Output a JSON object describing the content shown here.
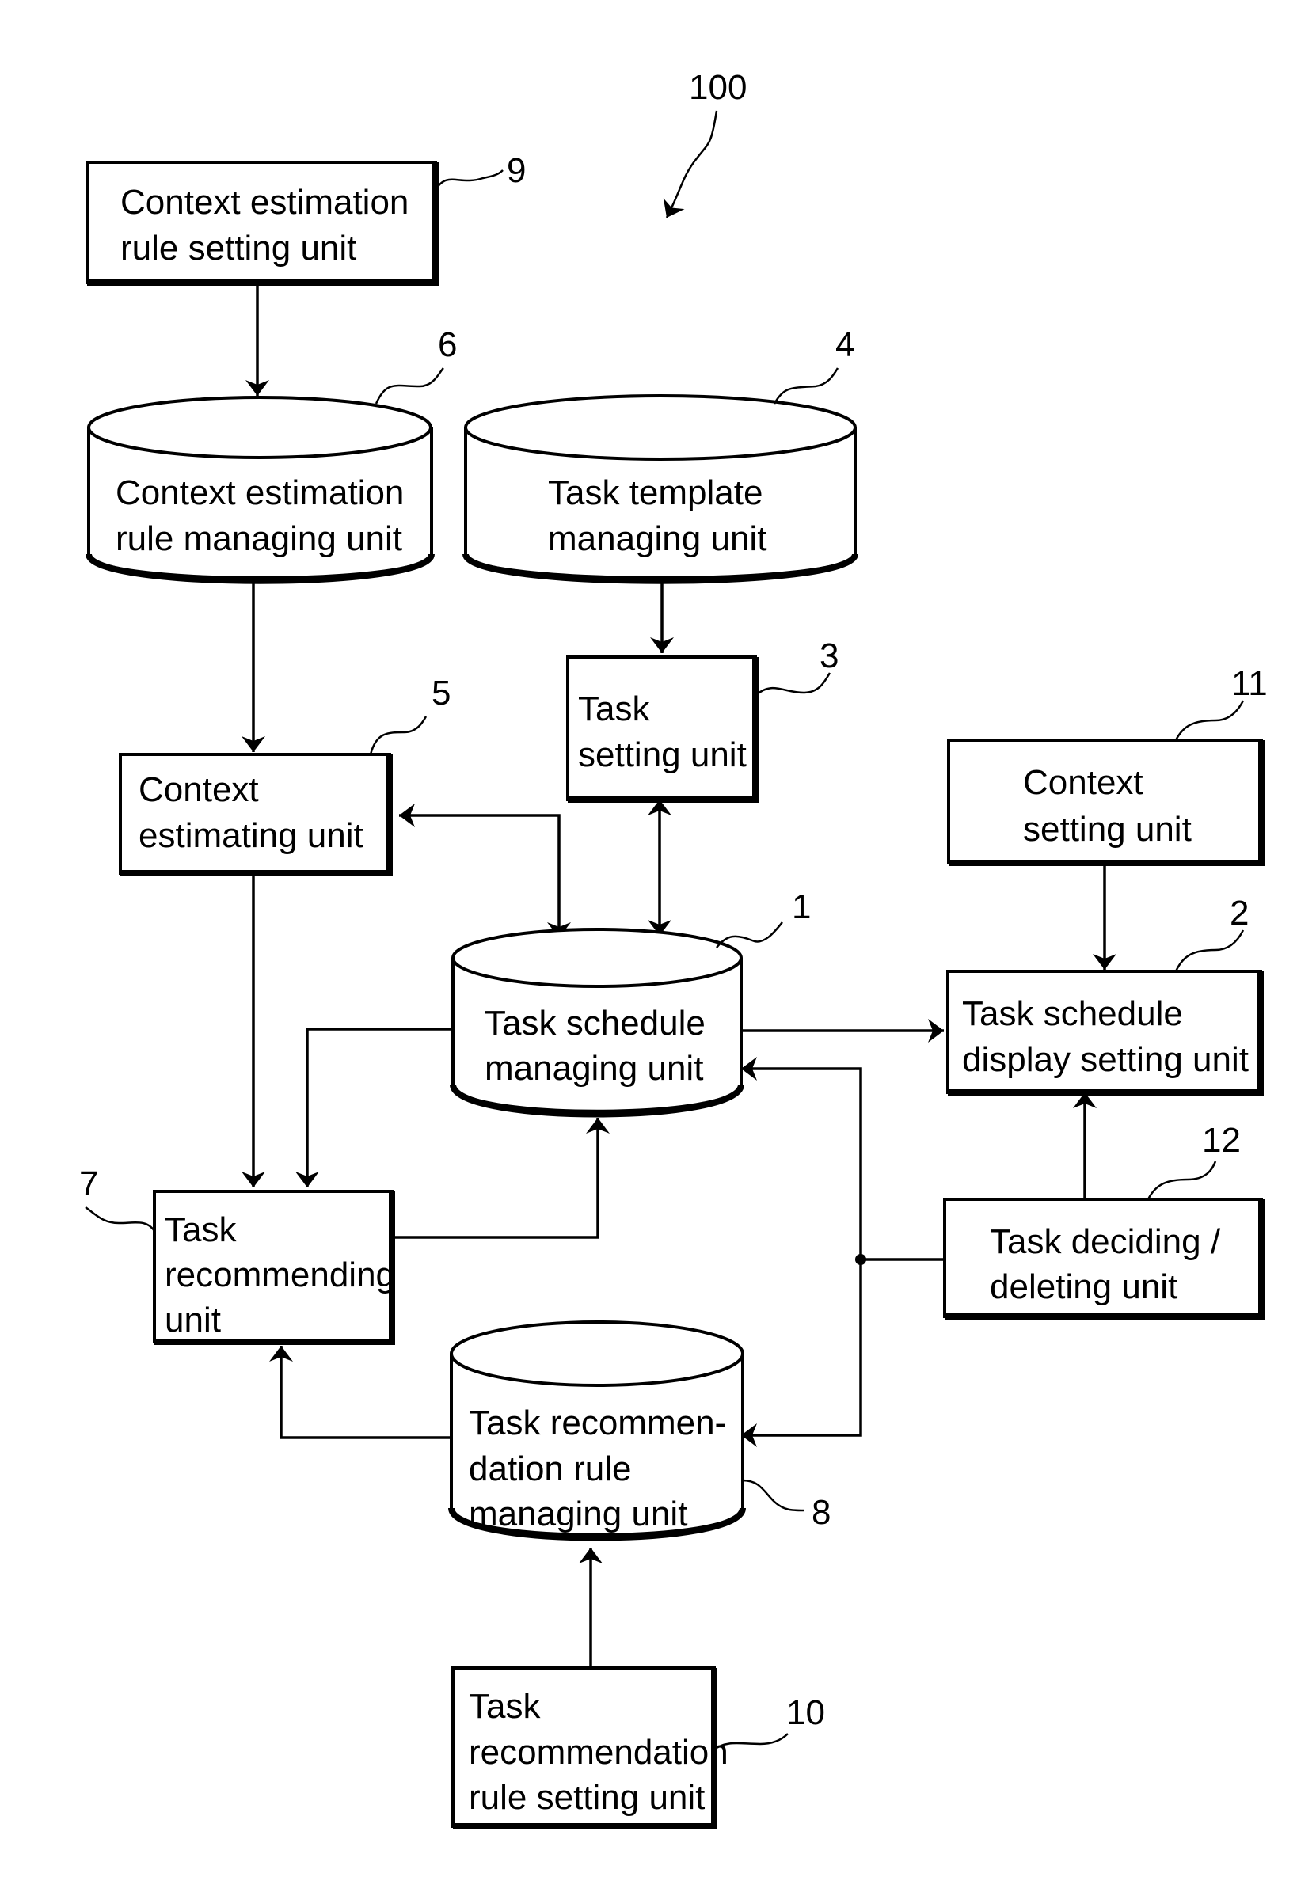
{
  "figure": {
    "reference": "100",
    "colors": {
      "stroke": "#000000",
      "background": "#ffffff"
    }
  },
  "units": {
    "u9": {
      "ref": "9",
      "shape": "box",
      "lines": [
        "Context estimation",
        "rule setting unit"
      ]
    },
    "u6": {
      "ref": "6",
      "shape": "cylinder",
      "lines": [
        "Context estimation",
        "rule managing unit"
      ]
    },
    "u4": {
      "ref": "4",
      "shape": "cylinder",
      "lines": [
        "Task template",
        "managing unit"
      ]
    },
    "u3": {
      "ref": "3",
      "shape": "box",
      "lines": [
        "Task",
        "setting unit"
      ]
    },
    "u5": {
      "ref": "5",
      "shape": "box",
      "lines": [
        "Context",
        "estimating unit"
      ]
    },
    "u11": {
      "ref": "11",
      "shape": "box",
      "lines": [
        "Context",
        "setting unit"
      ]
    },
    "u1": {
      "ref": "1",
      "shape": "cylinder",
      "lines": [
        "Task schedule",
        "managing unit"
      ]
    },
    "u2": {
      "ref": "2",
      "shape": "box",
      "lines": [
        "Task schedule",
        "display setting unit"
      ]
    },
    "u12": {
      "ref": "12",
      "shape": "box",
      "lines": [
        "Task deciding /",
        "deleting unit"
      ]
    },
    "u7": {
      "ref": "7",
      "shape": "box",
      "lines": [
        "Task",
        "recommending",
        "unit"
      ]
    },
    "u8": {
      "ref": "8",
      "shape": "cylinder",
      "lines": [
        "Task recommen-",
        "dation rule",
        "managing unit"
      ]
    },
    "u10": {
      "ref": "10",
      "shape": "box",
      "lines": [
        "Task",
        "recommendation",
        "rule setting unit"
      ]
    }
  },
  "connections": [
    {
      "from": "Context estimation rule setting unit",
      "to": "Context estimation rule managing unit",
      "type": "arrow"
    },
    {
      "from": "Context estimation rule managing unit",
      "to": "Context estimating unit",
      "type": "arrow"
    },
    {
      "from": "Task template managing unit",
      "to": "Task setting unit",
      "type": "arrow"
    },
    {
      "from": "Task setting unit",
      "to": "Task schedule managing unit",
      "type": "bidirectional"
    },
    {
      "from": "Context estimating unit",
      "to": "Task schedule managing unit",
      "type": "bidirectional"
    },
    {
      "from": "Context estimating unit",
      "to": "Task recommending unit",
      "type": "arrow"
    },
    {
      "from": "Task schedule managing unit",
      "to": "Task recommending unit",
      "type": "arrow"
    },
    {
      "from": "Task recommending unit",
      "to": "Task schedule managing unit",
      "type": "arrow"
    },
    {
      "from": "Task schedule managing unit",
      "to": "Task schedule display setting unit",
      "type": "arrow"
    },
    {
      "from": "Context setting unit",
      "to": "Task schedule display setting unit",
      "type": "arrow"
    },
    {
      "from": "Task deciding / deleting unit",
      "to": "Task schedule display setting unit",
      "type": "arrow"
    },
    {
      "from": "Task deciding / deleting unit",
      "to": "Task schedule managing unit",
      "type": "arrow"
    },
    {
      "from": "Task deciding / deleting unit",
      "to": "Task recommendation rule managing unit",
      "type": "arrow"
    },
    {
      "from": "Task recommendation rule managing unit",
      "to": "Task recommending unit",
      "type": "arrow"
    },
    {
      "from": "Task recommendation rule setting unit",
      "to": "Task recommendation rule managing unit",
      "type": "arrow"
    }
  ]
}
